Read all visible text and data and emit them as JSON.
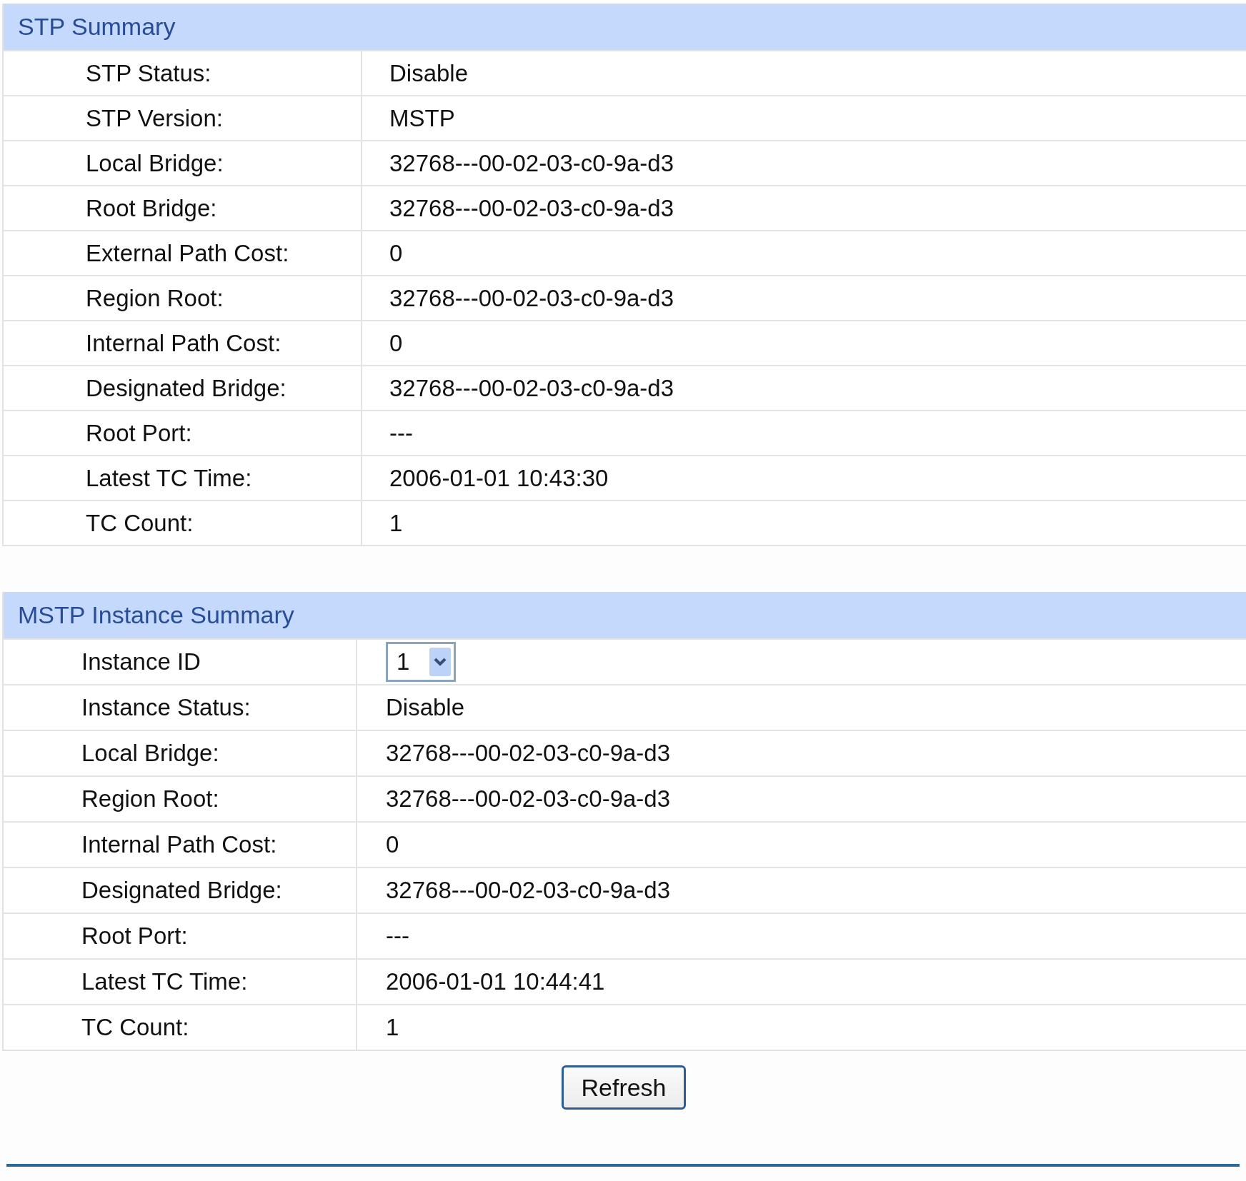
{
  "stp_summary": {
    "title": "STP Summary",
    "rows": [
      {
        "label": "STP Status:",
        "value": "Disable"
      },
      {
        "label": "STP Version:",
        "value": "MSTP"
      },
      {
        "label": "Local Bridge:",
        "value": "32768---00-02-03-c0-9a-d3"
      },
      {
        "label": "Root Bridge:",
        "value": "32768---00-02-03-c0-9a-d3"
      },
      {
        "label": "External Path Cost:",
        "value": "0"
      },
      {
        "label": "Region Root:",
        "value": "32768---00-02-03-c0-9a-d3"
      },
      {
        "label": "Internal Path Cost:",
        "value": "0"
      },
      {
        "label": "Designated Bridge:",
        "value": "32768---00-02-03-c0-9a-d3"
      },
      {
        "label": "Root Port:",
        "value": "---"
      },
      {
        "label": "Latest TC Time:",
        "value": "2006-01-01 10:43:30"
      },
      {
        "label": "TC Count:",
        "value": "1"
      }
    ]
  },
  "mstp_instance_summary": {
    "title": "MSTP Instance Summary",
    "rows": [
      {
        "kind": "select",
        "label": "Instance ID",
        "value": "1"
      },
      {
        "kind": "text",
        "label": "Instance Status:",
        "value": "Disable"
      },
      {
        "kind": "text",
        "label": "Local Bridge:",
        "value": "32768---00-02-03-c0-9a-d3"
      },
      {
        "kind": "text",
        "label": "Region Root:",
        "value": "32768---00-02-03-c0-9a-d3"
      },
      {
        "kind": "text",
        "label": "Internal Path Cost:",
        "value": "0"
      },
      {
        "kind": "text",
        "label": "Designated Bridge:",
        "value": "32768---00-02-03-c0-9a-d3"
      },
      {
        "kind": "text",
        "label": "Root Port:",
        "value": "---"
      },
      {
        "kind": "text",
        "label": "Latest TC Time:",
        "value": "2006-01-01 10:44:41"
      },
      {
        "kind": "text",
        "label": "TC Count:",
        "value": "1"
      }
    ]
  },
  "buttons": [
    "Refresh"
  ]
}
